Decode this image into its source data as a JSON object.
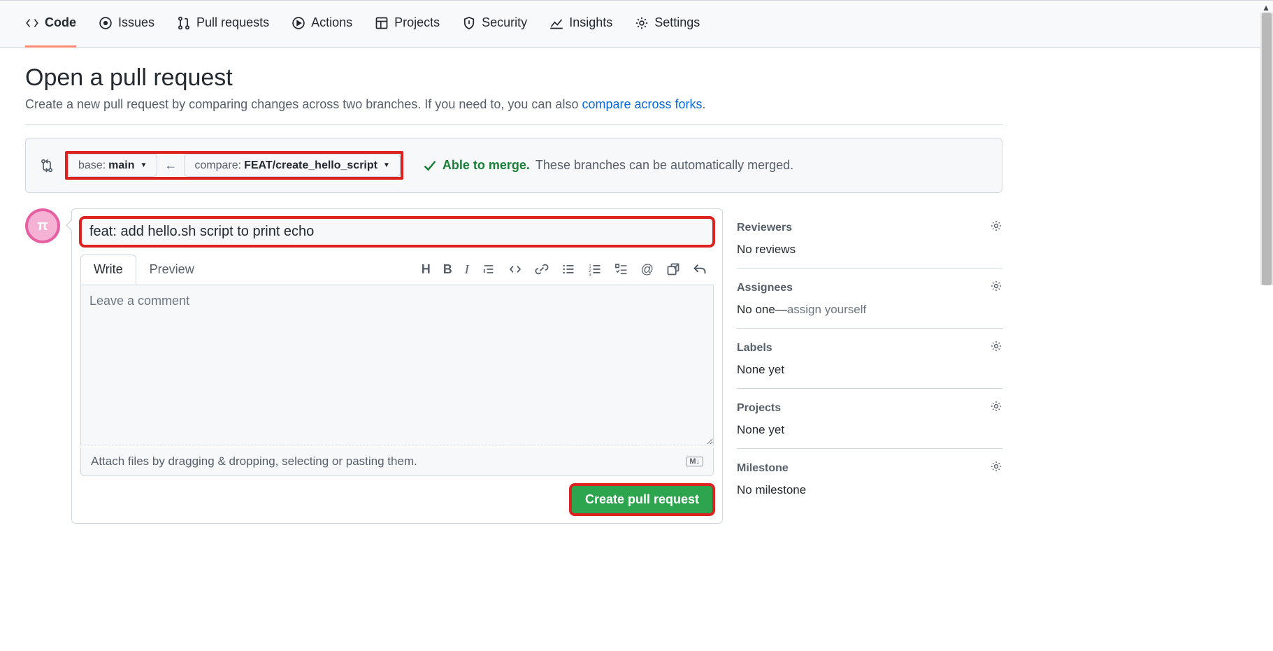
{
  "nav": {
    "code": "Code",
    "issues": "Issues",
    "pulls": "Pull requests",
    "actions": "Actions",
    "projects": "Projects",
    "security": "Security",
    "insights": "Insights",
    "settings": "Settings"
  },
  "heading": {
    "title": "Open a pull request",
    "subtitle_a": "Create a new pull request by comparing changes across two branches. If you need to, you can also ",
    "subtitle_link": "compare across forks",
    "subtitle_dot": "."
  },
  "compare": {
    "base_label": "base:",
    "base_value": "main",
    "compare_label": "compare:",
    "compare_value": "FEAT/create_hello_script",
    "merge_ok": "Able to merge.",
    "merge_rest": "These branches can be automatically merged."
  },
  "pr": {
    "title_value": "feat: add hello.sh script to print echo",
    "tab_write": "Write",
    "tab_preview": "Preview",
    "comment_placeholder": "Leave a comment",
    "attach_hint": "Attach files by dragging & dropping, selecting or pasting them.",
    "md_badge": "M↓",
    "submit": "Create pull request"
  },
  "side": {
    "reviewers": {
      "title": "Reviewers",
      "body": "No reviews"
    },
    "assignees": {
      "title": "Assignees",
      "body_a": "No one—",
      "body_link": "assign yourself"
    },
    "labels": {
      "title": "Labels",
      "body": "None yet"
    },
    "projects": {
      "title": "Projects",
      "body": "None yet"
    },
    "milestone": {
      "title": "Milestone",
      "body": "No milestone"
    }
  }
}
